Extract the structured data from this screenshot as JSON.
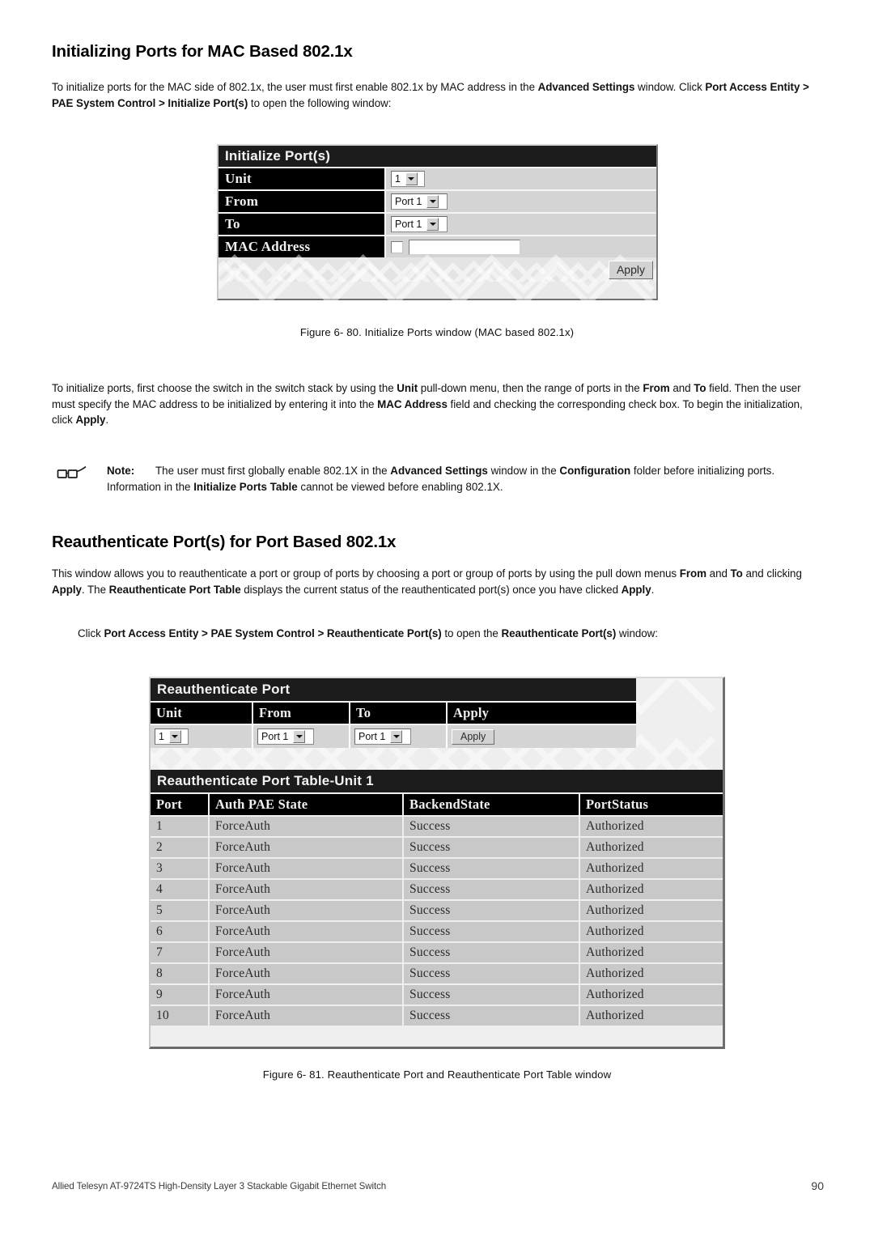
{
  "heading1": "Initializing Ports for MAC Based 802.1x",
  "para1": {
    "segments": [
      {
        "t": "To initialize ports for the MAC side of 802.1x, the user must first enable 802.1x by MAC address in the ",
        "b": false
      },
      {
        "t": "Advanced Settings",
        "b": true
      },
      {
        "t": " window. Click ",
        "b": false
      },
      {
        "t": "Port Access Entity > PAE System Control > Initialize Port(s)",
        "b": true
      },
      {
        "t": " to open the following window:",
        "b": false
      }
    ]
  },
  "figure1": {
    "title": "Initialize Port(s)",
    "rows": [
      {
        "label": "Unit",
        "control": "select",
        "value": "1",
        "width": "unit"
      },
      {
        "label": "From",
        "control": "select",
        "value": "Port 1",
        "width": "port"
      },
      {
        "label": "To",
        "control": "select",
        "value": "Port 1",
        "width": "port"
      },
      {
        "label": "MAC Address",
        "control": "checkbox-text",
        "value": "",
        "checkbox_checked": false
      }
    ],
    "apply_label": "Apply",
    "caption": "Figure 6- 80. Initialize Ports window (MAC based 802.1x)"
  },
  "para2": {
    "segments": [
      {
        "t": "To initialize ports, first choose the switch in the switch stack by using the ",
        "b": false
      },
      {
        "t": "Unit",
        "b": true
      },
      {
        "t": " pull-down menu, then the range of ports in the ",
        "b": false
      },
      {
        "t": "From",
        "b": true
      },
      {
        "t": " and ",
        "b": false
      },
      {
        "t": "To",
        "b": true
      },
      {
        "t": " field. Then the user must specify the MAC address to be initialized by entering it into the ",
        "b": false
      },
      {
        "t": "MAC Address",
        "b": true
      },
      {
        "t": " field and checking the corresponding check box. To begin the initialization, click ",
        "b": false
      },
      {
        "t": "Apply",
        "b": true
      },
      {
        "t": ".",
        "b": false
      }
    ]
  },
  "note": {
    "icon": "eyeglasses-icon",
    "label": "Note:",
    "segments": [
      {
        "t": "The user must first globally enable 802.1X in the ",
        "b": false
      },
      {
        "t": "Advanced Settings",
        "b": true
      },
      {
        "t": " window in the ",
        "b": false
      },
      {
        "t": "Configuration",
        "b": true
      },
      {
        "t": " folder before initializing ports. Information in the ",
        "b": false
      },
      {
        "t": "Initialize Ports Table",
        "b": true
      },
      {
        "t": " cannot be viewed before enabling 802.1X.",
        "b": false
      }
    ]
  },
  "heading2": "Reauthenticate Port(s) for Port Based 802.1x",
  "para3": {
    "segments": [
      {
        "t": "This window allows you to reauthenticate a port or group of ports by choosing a port or group of ports by using the pull down menus ",
        "b": false
      },
      {
        "t": "From",
        "b": true
      },
      {
        "t": " and ",
        "b": false
      },
      {
        "t": "To",
        "b": true
      },
      {
        "t": " and clicking ",
        "b": false
      },
      {
        "t": "Apply",
        "b": true
      },
      {
        "t": ". The ",
        "b": false
      },
      {
        "t": "Reauthenticate Port Table",
        "b": true
      },
      {
        "t": " displays the current status of the reauthenticated port(s) once you have clicked ",
        "b": false
      },
      {
        "t": "Apply",
        "b": true
      },
      {
        "t": ".",
        "b": false
      }
    ]
  },
  "para4": {
    "segments": [
      {
        "t": "Click ",
        "b": false
      },
      {
        "t": "Port Access Entity > PAE System Control > Reauthenticate Port(s)",
        "b": true
      },
      {
        "t": " to open the ",
        "b": false
      },
      {
        "t": "Reauthenticate Port(s)",
        "b": true
      },
      {
        "t": " window:",
        "b": false
      }
    ]
  },
  "figure2": {
    "panel_title": "Reauthenticate Port",
    "panel_headers": [
      "Unit",
      "From",
      "To",
      "Apply"
    ],
    "unit_value": "1",
    "from_value": "Port 1",
    "to_value": "Port 1",
    "apply_label": "Apply",
    "table_title": "Reauthenticate Port Table-Unit 1",
    "table_headers": [
      "Port",
      "Auth PAE State",
      "BackendState",
      "PortStatus"
    ],
    "table_rows": [
      [
        "1",
        "ForceAuth",
        "Success",
        "Authorized"
      ],
      [
        "2",
        "ForceAuth",
        "Success",
        "Authorized"
      ],
      [
        "3",
        "ForceAuth",
        "Success",
        "Authorized"
      ],
      [
        "4",
        "ForceAuth",
        "Success",
        "Authorized"
      ],
      [
        "5",
        "ForceAuth",
        "Success",
        "Authorized"
      ],
      [
        "6",
        "ForceAuth",
        "Success",
        "Authorized"
      ],
      [
        "7",
        "ForceAuth",
        "Success",
        "Authorized"
      ],
      [
        "8",
        "ForceAuth",
        "Success",
        "Authorized"
      ],
      [
        "9",
        "ForceAuth",
        "Success",
        "Authorized"
      ],
      [
        "10",
        "ForceAuth",
        "Success",
        "Authorized"
      ]
    ],
    "caption": "Figure 6- 81. Reauthenticate Port and Reauthenticate Port Table window"
  },
  "footer": {
    "text": "Allied Telesyn AT-9724TS High-Density Layer 3 Stackable Gigabit Ethernet Switch",
    "page": "90"
  },
  "colors": {
    "title_bar": "#1c1c1c",
    "label_bg": "#000000",
    "value_bg": "#d4d4d4",
    "row_bg": "#c8c8c8",
    "page_bg": "#ffffff"
  }
}
